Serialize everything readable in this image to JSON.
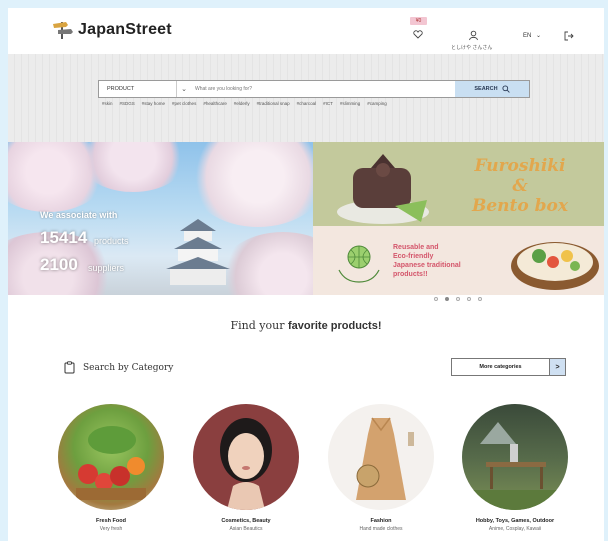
{
  "brand": {
    "name": "JapanStreet"
  },
  "header": {
    "cart_badge": "¥0",
    "user_name": "としけや さんさん",
    "lang": "EN"
  },
  "search": {
    "category": "PRODUCT",
    "placeholder": "What are you looking for?",
    "button": "SEARCH"
  },
  "tags": [
    "#skin",
    "#SDGS",
    "#stay home",
    "#pet clothes",
    "#healthcare",
    "#elderly",
    "#traditional snap",
    "#charcoal",
    "#ICT",
    "#slimming",
    "#camping"
  ],
  "banner_left": {
    "intro": "We associate with",
    "products_count": "15414",
    "products_unit": "products",
    "suppliers_count": "2100",
    "suppliers_unit": "suppliers"
  },
  "banner_right": {
    "title_1": "Furoshiki",
    "title_amp": "&",
    "title_2": "Bento box",
    "line_1": "Reusable and",
    "line_2": "Eco-friendly",
    "line_3": "Japanese traditional",
    "line_4": "products!!"
  },
  "carousel": {
    "slides": 5,
    "active": 1
  },
  "headline": {
    "prefix": "Find your",
    "bold": "favorite products!"
  },
  "category_section": {
    "title": "Search by Category",
    "more_label": "More categories",
    "more_arrow": ">"
  },
  "categories": [
    {
      "name": "Fresh Food",
      "sub": "Very fresh"
    },
    {
      "name": "Cosmetics, Beauty",
      "sub": "Asian Beautics"
    },
    {
      "name": "Fashion",
      "sub": "Hand made clothes"
    },
    {
      "name": "Hobby, Toys, Games, Outdoor",
      "sub": "Anime, Cosplay, Kawaii"
    }
  ],
  "colors": {
    "accent_blue": "#c9dff2",
    "title_gold": "#e2a74d",
    "pink_text": "#d4566b",
    "page_bg": "#dff1fb"
  }
}
